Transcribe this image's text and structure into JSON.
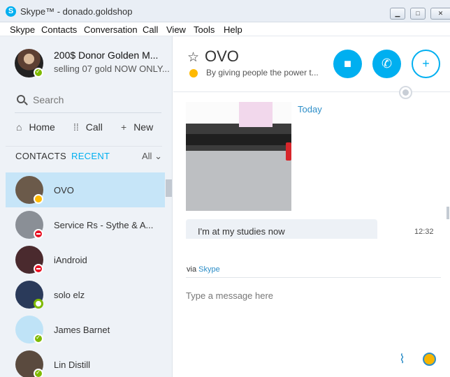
{
  "window": {
    "title": "Skype™ - donado.goldshop",
    "app_icon": "S",
    "minimize": "▁",
    "maximize": "□",
    "close": "✕"
  },
  "menu": [
    "Skype",
    "Contacts",
    "Conversation",
    "Call",
    "View",
    "Tools",
    "Help"
  ],
  "profile": {
    "name": "200$ Donor Golden M...",
    "mood": "selling 07 gold NOW ONLY..."
  },
  "search": {
    "placeholder": "Search"
  },
  "nav": {
    "home": "Home",
    "call": "Call",
    "new": "New"
  },
  "tabs": {
    "contacts": "CONTACTS",
    "recent": "RECENT",
    "filter": "All"
  },
  "contacts": [
    {
      "name": "OVO",
      "status": "away",
      "color": "#6b5a4a"
    },
    {
      "name": "Service Rs - Sythe & A...",
      "status": "busy",
      "color": "#8a8f96"
    },
    {
      "name": "iAndroid",
      "status": "busy",
      "color": "#4a2a2e"
    },
    {
      "name": "solo elz",
      "status": "offline",
      "color": "#2a3a5a"
    },
    {
      "name": "James Barnet",
      "status": "online",
      "color": "#bfe3f7"
    },
    {
      "name": "Lin Distill",
      "status": "online",
      "color": "#5a4a3e"
    }
  ],
  "conversation": {
    "title": "OVO",
    "mood": "By giving people the power t...",
    "date_label": "Today",
    "message": "I'm at my studies now",
    "message_time": "12:32",
    "via_prefix": "via",
    "via_link": "Skype",
    "compose_placeholder": "Type a message here"
  },
  "colors": {
    "accent": "#00aff0",
    "online": "#7fba00",
    "away": "#ffb900",
    "busy": "#e81123"
  }
}
